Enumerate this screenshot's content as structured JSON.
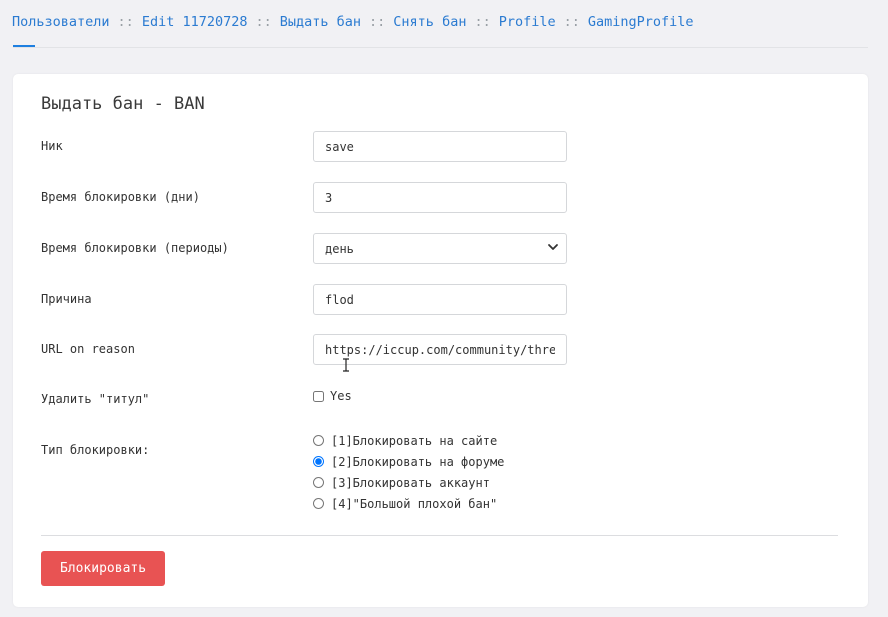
{
  "breadcrumb": {
    "separator": "::",
    "items": [
      "Пользователи",
      "Edit 11720728",
      "Выдать бан",
      "Снять бан",
      "Profile",
      "GamingProfile"
    ]
  },
  "form": {
    "title": "Выдать бан - BAN",
    "nick": {
      "label": "Ник",
      "value": "save"
    },
    "days": {
      "label": "Время блокировки (дни)",
      "value": "3"
    },
    "period": {
      "label": "Время блокировки (периоды)",
      "selected": "день"
    },
    "reason": {
      "label": "Причина",
      "value": "flod"
    },
    "url": {
      "label": "URL on reason",
      "value": "https://iccup.com/community/thread"
    },
    "remove_title": {
      "label": "Удалить \"титул\"",
      "checkbox_label": "Yes",
      "checked": false
    },
    "ban_type": {
      "label": "Тип блокировки:",
      "options": [
        "[1]Блокировать на сайте",
        "[2]Блокировать на форуме",
        "[3]Блокировать аккаунт",
        "[4]\"Большой плохой бан\""
      ],
      "selected_index": 1
    },
    "submit_label": "Блокировать"
  },
  "colors": {
    "link": "#2b7bd1",
    "accent": "#1e7fe0",
    "danger": "#e85353"
  }
}
